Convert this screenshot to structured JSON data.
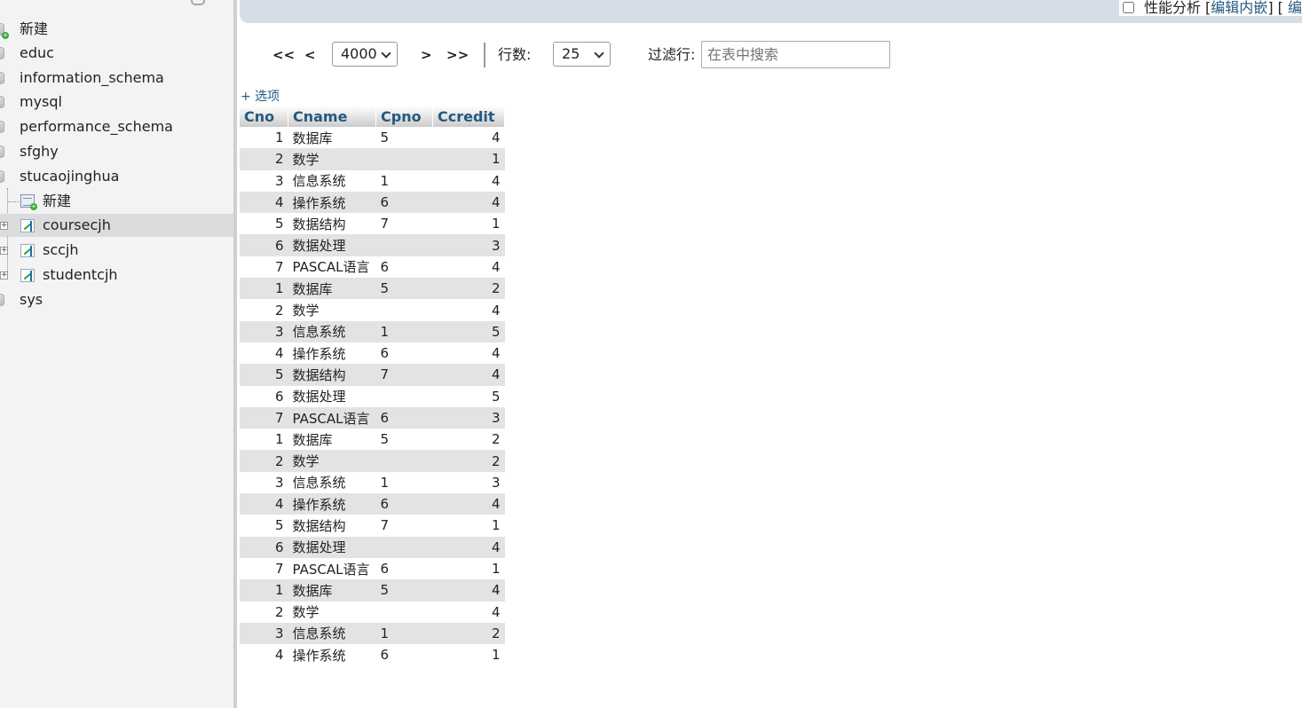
{
  "sidebar": {
    "items": [
      {
        "label": "新建",
        "type": "new-db"
      },
      {
        "label": "educ",
        "type": "db"
      },
      {
        "label": "information_schema",
        "type": "db"
      },
      {
        "label": "mysql",
        "type": "db"
      },
      {
        "label": "performance_schema",
        "type": "db"
      },
      {
        "label": "sfghy",
        "type": "db"
      },
      {
        "label": "stucaojinghua",
        "type": "db"
      }
    ],
    "children": [
      {
        "label": "新建",
        "type": "new-table"
      },
      {
        "label": "coursecjh",
        "type": "view",
        "selected": true
      },
      {
        "label": "sccjh",
        "type": "view"
      },
      {
        "label": "studentcjh",
        "type": "view"
      }
    ],
    "tail": [
      {
        "label": "sys",
        "type": "db"
      }
    ]
  },
  "top_bar": {
    "profiling_label": "性能分析",
    "bracket_open": "[",
    "edit_inline_label": "编辑内嵌",
    "bracket_mid": "] [",
    "edit_label": "编"
  },
  "navigation": {
    "first": "<<",
    "prev": "<",
    "page_select_value": "4000",
    "next": ">",
    "last": ">>",
    "rows_label": "行数:",
    "rows_select_value": "25",
    "filter_label": "过滤行:",
    "filter_placeholder": "在表中搜索",
    "options_link": "+ 选项"
  },
  "table": {
    "columns": [
      "Cno",
      "Cname",
      "Cpno",
      "Ccredit"
    ],
    "rows": [
      [
        "1",
        "数据库",
        "5",
        "4"
      ],
      [
        "2",
        "数学",
        "",
        "1"
      ],
      [
        "3",
        "信息系统",
        "1",
        "4"
      ],
      [
        "4",
        "操作系统",
        "6",
        "4"
      ],
      [
        "5",
        "数据结构",
        "7",
        "1"
      ],
      [
        "6",
        "数据处理",
        "",
        "3"
      ],
      [
        "7",
        "PASCAL语言",
        "6",
        "4"
      ],
      [
        "1",
        "数据库",
        "5",
        "2"
      ],
      [
        "2",
        "数学",
        "",
        "4"
      ],
      [
        "3",
        "信息系统",
        "1",
        "5"
      ],
      [
        "4",
        "操作系统",
        "6",
        "4"
      ],
      [
        "5",
        "数据结构",
        "7",
        "4"
      ],
      [
        "6",
        "数据处理",
        "",
        "5"
      ],
      [
        "7",
        "PASCAL语言",
        "6",
        "3"
      ],
      [
        "1",
        "数据库",
        "5",
        "2"
      ],
      [
        "2",
        "数学",
        "",
        "2"
      ],
      [
        "3",
        "信息系统",
        "1",
        "3"
      ],
      [
        "4",
        "操作系统",
        "6",
        "4"
      ],
      [
        "5",
        "数据结构",
        "7",
        "1"
      ],
      [
        "6",
        "数据处理",
        "",
        "4"
      ],
      [
        "7",
        "PASCAL语言",
        "6",
        "1"
      ],
      [
        "1",
        "数据库",
        "5",
        "4"
      ],
      [
        "2",
        "数学",
        "",
        "4"
      ],
      [
        "3",
        "信息系统",
        "1",
        "2"
      ],
      [
        "4",
        "操作系统",
        "6",
        "1"
      ]
    ]
  }
}
